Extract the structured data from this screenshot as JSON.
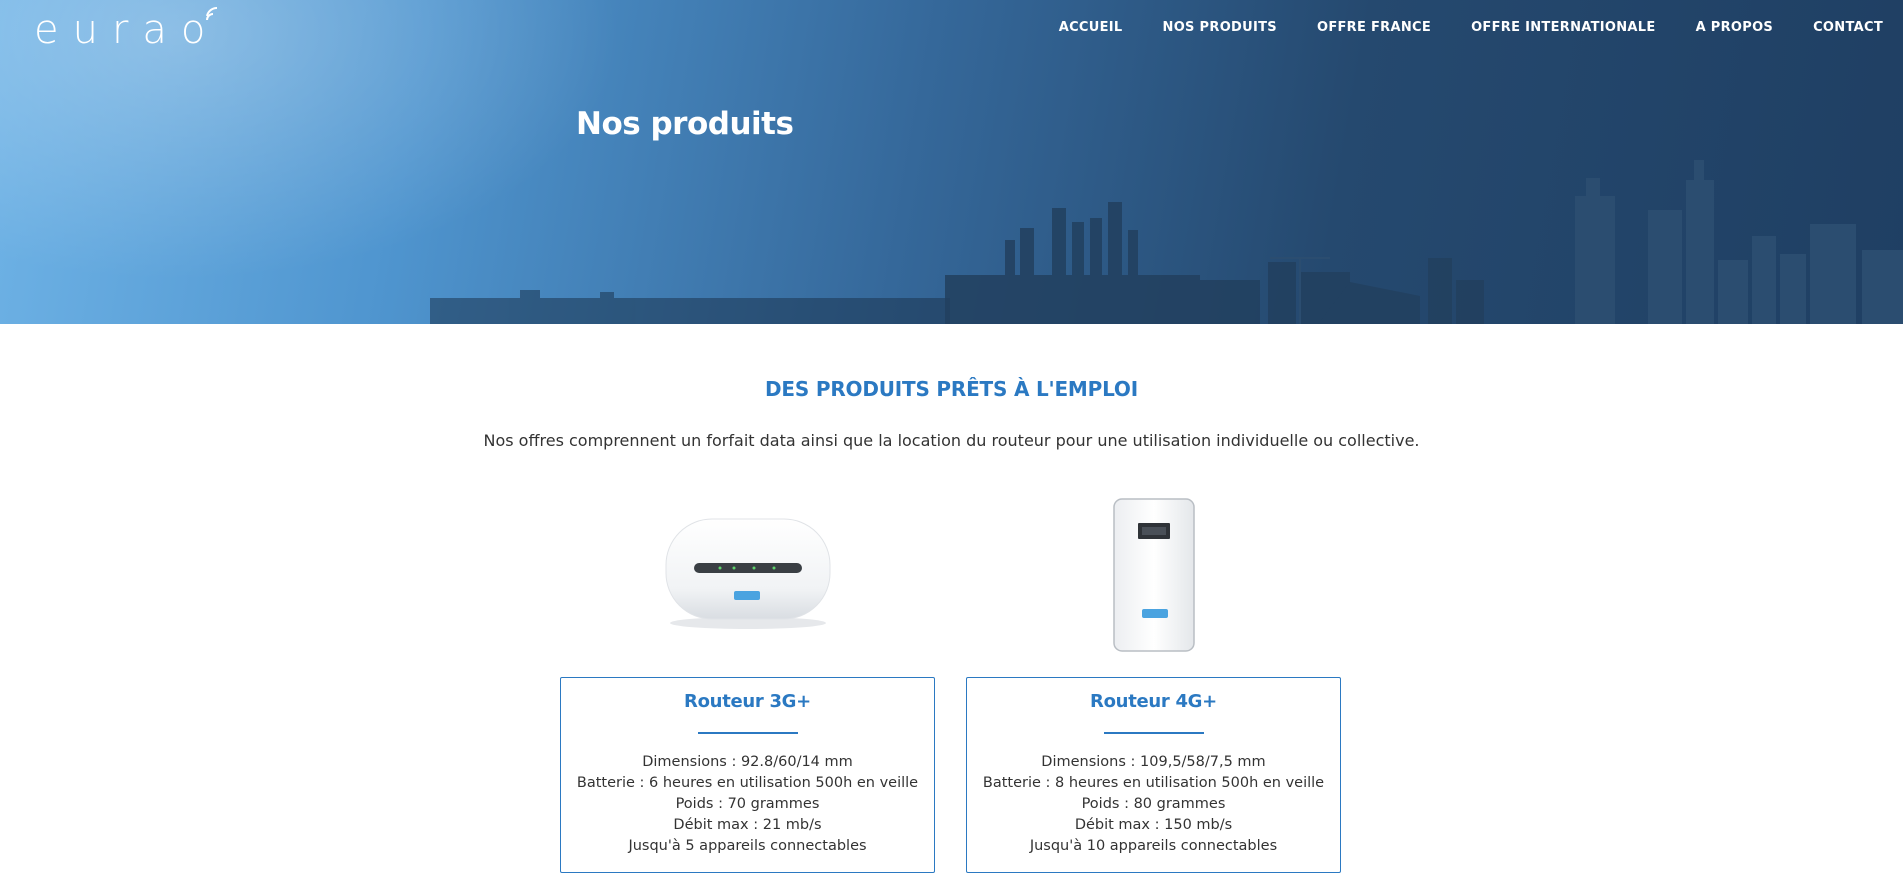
{
  "brand": {
    "logo_text": "eurao"
  },
  "nav": {
    "items": [
      {
        "label": "ACCUEIL"
      },
      {
        "label": "NOS PRODUITS"
      },
      {
        "label": "OFFRE FRANCE"
      },
      {
        "label": "OFFRE INTERNATIONALE"
      },
      {
        "label": "A PROPOS"
      },
      {
        "label": "CONTACT"
      }
    ]
  },
  "hero": {
    "title": "Nos produits"
  },
  "section": {
    "title": "DES PRODUITS PRÊTS À L'EMPLOI",
    "intro": "Nos offres comprennent un forfait data ainsi que la location du routeur pour une utilisation individuelle ou collective."
  },
  "products": [
    {
      "name": "Routeur 3G+",
      "specs": [
        "Dimensions : 92.8/60/14 mm",
        "Batterie : 6 heures en utilisation 500h en veille",
        "Poids : 70 grammes",
        "Débit max : 21 mb/s",
        "Jusqu'à 5 appareils connectables"
      ]
    },
    {
      "name": "Routeur 4G+",
      "specs": [
        "Dimensions : 109,5/58/7,5 mm",
        "Batterie : 8 heures en utilisation 500h en veille",
        "Poids : 80 grammes",
        "Débit max : 150 mb/s",
        "Jusqu'à 10 appareils connectables"
      ]
    }
  ],
  "colors": {
    "accent": "#2b79c2",
    "hero_light": "#6fb3e6",
    "hero_dark": "#1f3f63",
    "body_text": "#333333"
  },
  "icons": {
    "logo_waves": "wifi-waves-icon",
    "router_3g": "router-3g-image",
    "router_4g": "router-4g-image"
  }
}
